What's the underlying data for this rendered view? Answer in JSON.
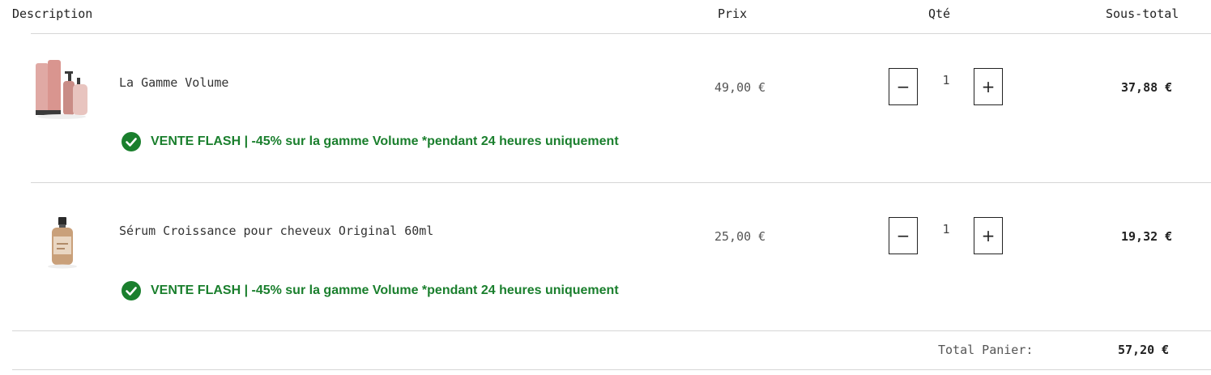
{
  "headers": {
    "description": "Description",
    "price": "Prix",
    "qty": "Qté",
    "subtotal": "Sous-total"
  },
  "items": [
    {
      "name": "La Gamme Volume",
      "price": "49,00 €",
      "qty": "1",
      "subtotal": "37,88 €",
      "promo": "VENTE FLASH | -45% sur la gamme Volume *pendant 24 heures uniquement",
      "image_icon": "product-volume-set-icon"
    },
    {
      "name": "Sérum Croissance pour cheveux Original 60ml",
      "price": "25,00 €",
      "qty": "1",
      "subtotal": "19,32 €",
      "promo": "VENTE FLASH | -45% sur la gamme Volume *pendant 24 heures uniquement",
      "image_icon": "product-serum-bottle-icon"
    }
  ],
  "controls": {
    "minus": "−",
    "plus": "+"
  },
  "total": {
    "label": "Total Panier:",
    "value": "57,20 €"
  },
  "colors": {
    "promo_green": "#1a7f2d",
    "divider": "#d6d6d6"
  }
}
